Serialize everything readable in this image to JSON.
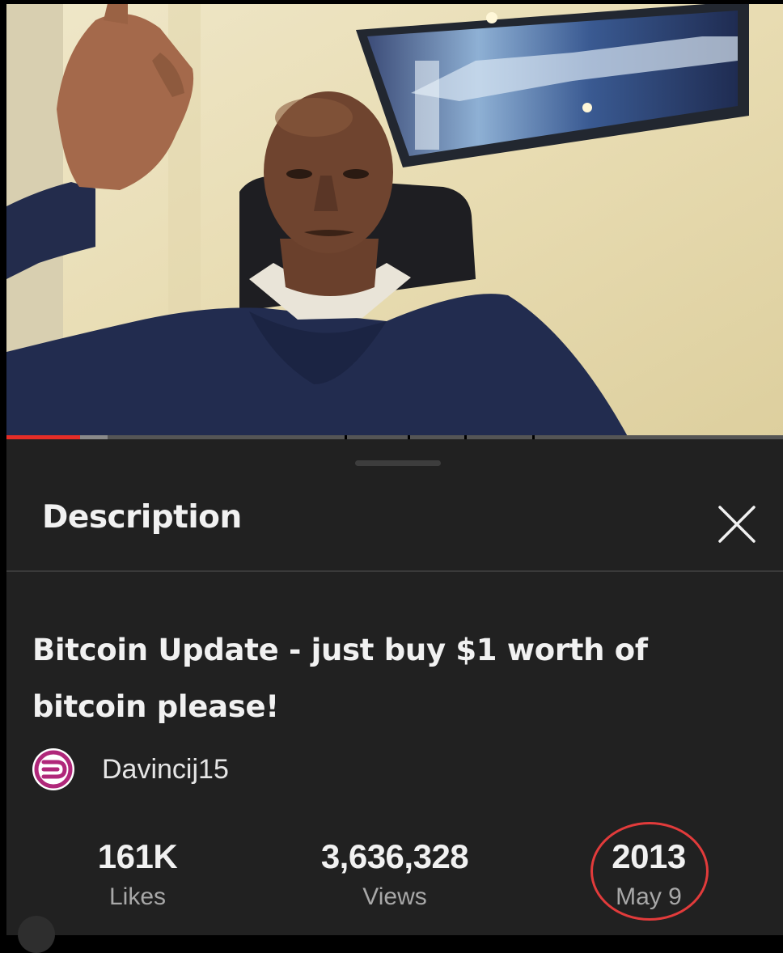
{
  "panel": {
    "title": "Description",
    "close_icon": "close-icon"
  },
  "video": {
    "title": "Bitcoin Update - just buy $1 worth of bitcoin please!",
    "progress": 0.095,
    "buffered": 0.13
  },
  "channel": {
    "name": "Davincij15",
    "avatar_icon": "channel-logo-icon"
  },
  "stats": {
    "likes": {
      "value": "161K",
      "label": "Likes"
    },
    "views": {
      "value": "3,636,328",
      "label": "Views"
    },
    "date": {
      "value": "2013",
      "label": "May 9"
    }
  },
  "colors": {
    "sheet_background": "#212121",
    "progress_red": "#e52d27",
    "annotation_red": "#e23b3b",
    "avatar_accent": "#b0277a"
  }
}
